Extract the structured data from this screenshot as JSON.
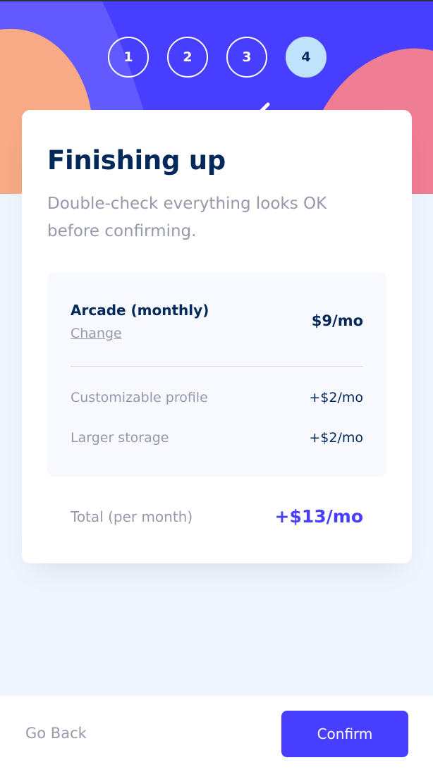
{
  "steps": [
    {
      "number": "1",
      "active": false
    },
    {
      "number": "2",
      "active": false
    },
    {
      "number": "3",
      "active": false
    },
    {
      "number": "4",
      "active": true
    }
  ],
  "card": {
    "title": "Finishing up",
    "subtitle": "Double-check everything looks OK before confirming."
  },
  "summary": {
    "plan_name": "Arcade (monthly)",
    "change_label": "Change",
    "plan_price": "$9/mo",
    "addons": [
      {
        "name": "Customizable profile",
        "price": "+$2/mo"
      },
      {
        "name": "Larger storage",
        "price": "+$2/mo"
      }
    ]
  },
  "total": {
    "label": "Total (per month)",
    "price": "+$13/mo"
  },
  "footer": {
    "back_label": "Go Back",
    "confirm_label": "Confirm"
  },
  "colors": {
    "primary": "#483eff",
    "marine": "#022959",
    "grey": "#9699aa",
    "light_blue": "#bfe2fd",
    "background": "#eff5ff",
    "orange": "#ffaf7e",
    "pink": "#f9818e"
  }
}
